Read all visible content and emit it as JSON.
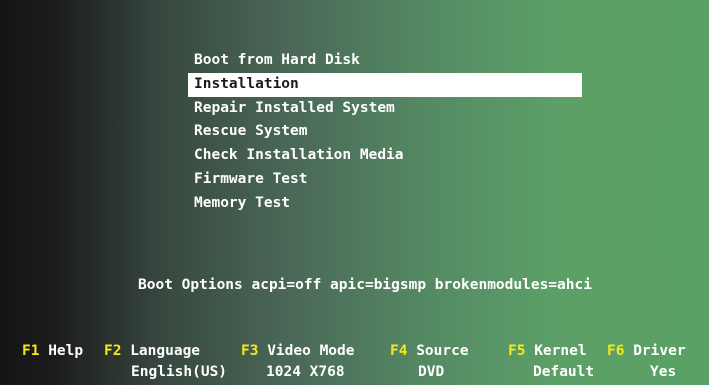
{
  "menu": {
    "items": [
      {
        "label": "Boot from Hard Disk"
      },
      {
        "label": "Installation",
        "selected": true
      },
      {
        "label": "Repair Installed System"
      },
      {
        "label": "Rescue System"
      },
      {
        "label": "Check Installation Media"
      },
      {
        "label": "Firmware Test"
      },
      {
        "label": "Memory Test"
      }
    ]
  },
  "boot_options": {
    "text": "Boot Options acpi=off apic=bigsmp brokenmodules=ahci"
  },
  "function_keys": {
    "f1": {
      "key": "F1",
      "label": "Help"
    },
    "f2": {
      "key": "F2",
      "label": "Language",
      "value": "English(US)"
    },
    "f3": {
      "key": "F3",
      "label": "Video Mode",
      "value": "1024 X768"
    },
    "f4": {
      "key": "F4",
      "label": "Source",
      "value": "DVD"
    },
    "f5": {
      "key": "F5",
      "label": "Kernel",
      "value": "Default"
    },
    "f6": {
      "key": "F6",
      "label": "Driver",
      "value": "Yes"
    }
  },
  "colors": {
    "key_color": "#f5e81c",
    "selection_bg": "#ffffff",
    "selection_fg": "#1a1a1a"
  }
}
